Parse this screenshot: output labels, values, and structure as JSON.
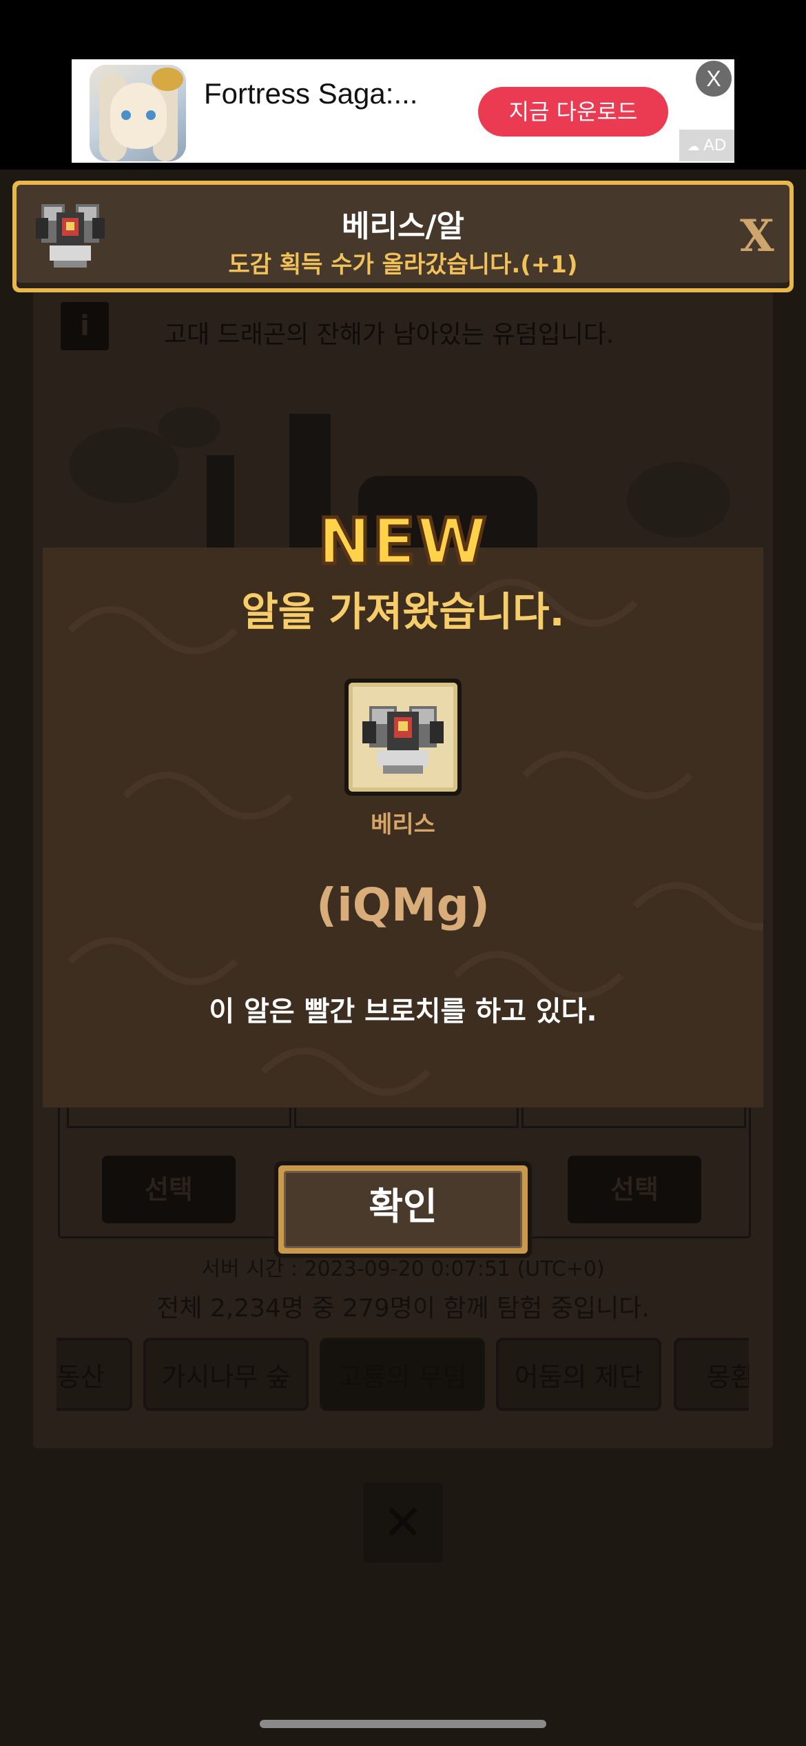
{
  "ad": {
    "title": "Fortress Saga:...",
    "cta": "지금 다운로드",
    "close": "X",
    "badge": "AD"
  },
  "notification": {
    "title": "베리스/알",
    "subtitle": "도감 획득 수가 올라갔습니다.(+1)",
    "close": "X"
  },
  "background": {
    "info_text": "고대 드래곤의 잔해가 남아있는 유덤입니다.",
    "select_left": "선택",
    "select_right": "선택",
    "server_time": "서버 시간 : 2023-09-20 0:07:51 (UTC+0)",
    "user_count": "전체 2,234명 중 279명이 함께 탐험 중입니다.",
    "tabs": [
      "동산",
      "가시나무 숲",
      "고룡의 무덤",
      "어둠의 제단",
      "몽환의"
    ]
  },
  "modal": {
    "new_label": "NEW",
    "title": "알을 가져왔습니다.",
    "item_name": "베리스",
    "item_code": "(iQMg)",
    "description": "이 알은 빨간 브로치를 하고 있다.",
    "confirm": "확인"
  },
  "colors": {
    "accent_gold": "#f7cd6a",
    "ad_cta": "#ea3b52",
    "modal_bg": "#3d2e20"
  }
}
